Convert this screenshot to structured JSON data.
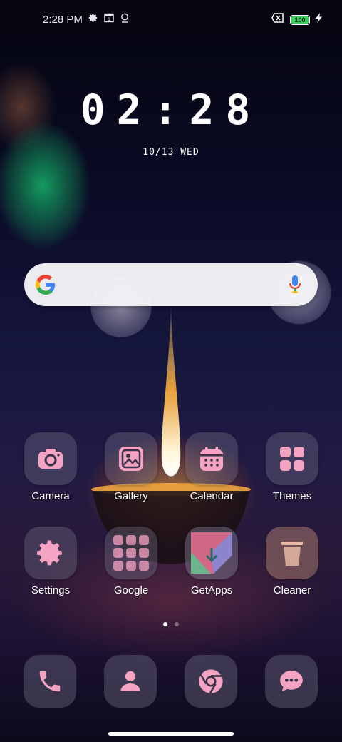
{
  "status_bar": {
    "time": "2:28 PM",
    "battery": "100"
  },
  "clock": {
    "time": "02:28",
    "date": "10/13 WED"
  },
  "apps": [
    {
      "label": "Camera",
      "icon": "camera-icon"
    },
    {
      "label": "Gallery",
      "icon": "gallery-icon"
    },
    {
      "label": "Calendar",
      "icon": "calendar-icon"
    },
    {
      "label": "Themes",
      "icon": "themes-icon"
    },
    {
      "label": "Settings",
      "icon": "settings-icon"
    },
    {
      "label": "Google",
      "icon": "folder-icon"
    },
    {
      "label": "GetApps",
      "icon": "getapps-icon"
    },
    {
      "label": "Cleaner",
      "icon": "trash-icon"
    }
  ],
  "dock": [
    {
      "icon": "phone-icon"
    },
    {
      "icon": "contacts-icon"
    },
    {
      "icon": "chrome-icon"
    },
    {
      "icon": "messages-icon"
    }
  ],
  "page_indicator": {
    "count": 2,
    "active": 0
  },
  "colors": {
    "icon_accent": "#f5a3c2",
    "battery_green": "#33d35a"
  }
}
